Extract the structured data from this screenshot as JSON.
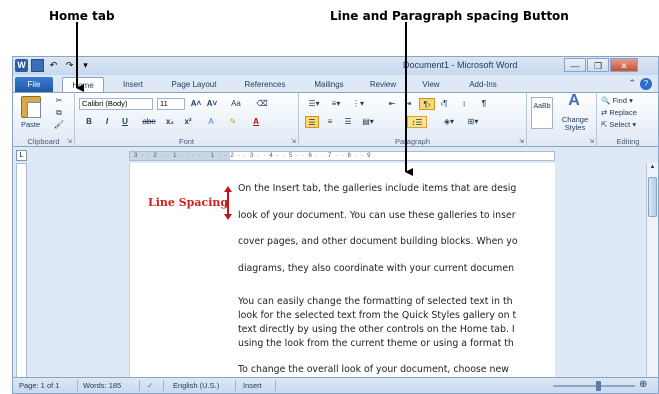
{
  "annotations": {
    "home_tab": "Home tab",
    "line_paragraph_button": "Line and Paragraph spacing Button",
    "line_spacing": "Line Spacing"
  },
  "window": {
    "title": "Document1 - Microsoft Word",
    "qat_icons": [
      "word-logo-icon",
      "save-icon",
      "undo-icon",
      "redo-icon",
      "customize-qat-icon"
    ]
  },
  "tabs": {
    "file": "File",
    "home": "Home",
    "insert": "Insert",
    "page_layout": "Page Layout",
    "references": "References",
    "mailings": "Mailings",
    "review": "Review",
    "view": "View",
    "addins": "Add-Ins"
  },
  "ribbon": {
    "clipboard": {
      "paste": "Paste",
      "label": "Clipboard"
    },
    "font": {
      "name": "Calibri (Body)",
      "size": "11",
      "grow": "A˄",
      "shrink": "A˅",
      "change_case": "Aa",
      "bold": "B",
      "italic": "I",
      "underline": "U",
      "strike": "abe",
      "subscript": "x₂",
      "superscript": "x²",
      "font_color": "A",
      "label": "Font"
    },
    "paragraph": {
      "label": "Paragraph"
    },
    "styles": {
      "change_styles": "Change Styles",
      "styles_preview": "AaBb"
    },
    "editing": {
      "find": "Find",
      "replace": "Replace",
      "select": "Select",
      "label": "Editing"
    }
  },
  "ruler": {
    "ticks": "3 · · 2 · · 1 · · · · · 1 · · 2 · · 3 · · 4 · · 5 · · 6 · · 7 · · 8 · · 9"
  },
  "document": {
    "lines": [
      "On the Insert tab, the galleries include items that are desig",
      "look of your document. You can use these galleries to inser",
      "cover pages, and other document building blocks. When yo",
      "diagrams, they also coordinate with your current documen",
      "You can easily change the formatting of selected text in th",
      "look for the selected text from the Quick Styles gallery on t",
      "text directly by using the other controls on the Home tab. I",
      "using the look from the current theme or using a format th",
      "To change the overall look of your document, choose new"
    ]
  },
  "statusbar": {
    "page": "Page: 1 of 1",
    "words": "Words: 185",
    "language": "English (U.S.)",
    "mode": "Insert"
  },
  "colors": {
    "ribbon_bg": "#dfe9f5",
    "file_tab": "#2a62b4",
    "line_spacing_label": "#d02020",
    "paragraph_highlight": "#ffd86b"
  }
}
